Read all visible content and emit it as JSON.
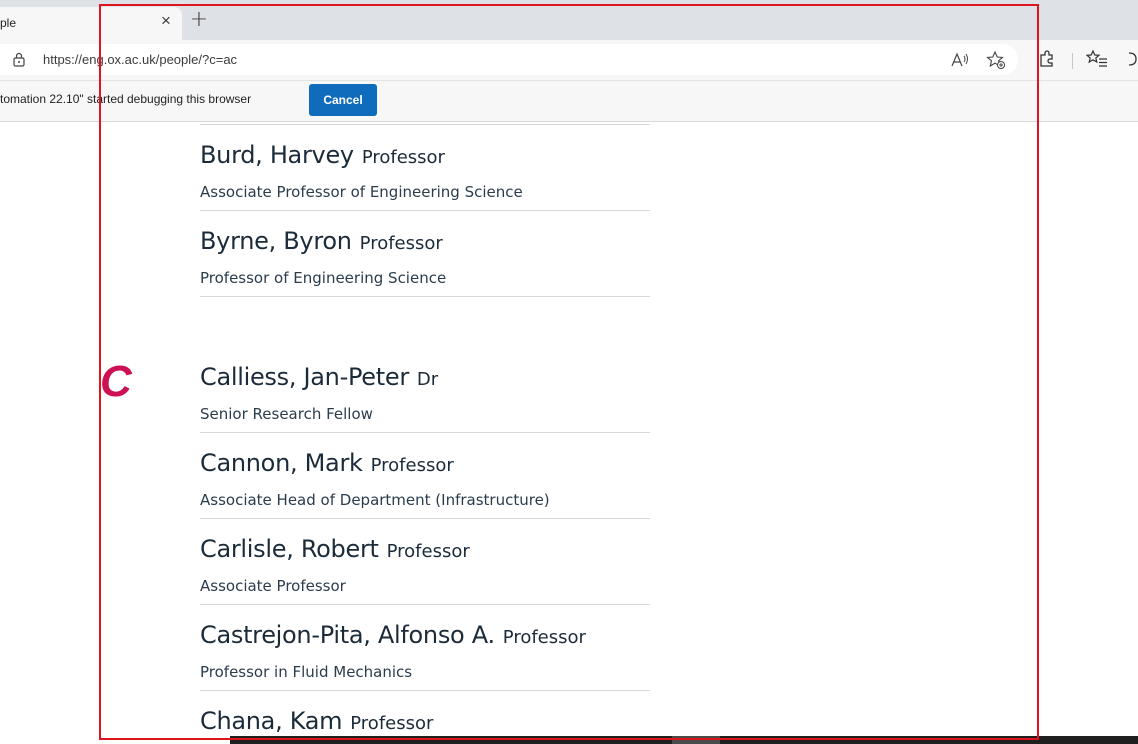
{
  "browser": {
    "tab": {
      "title": "ple",
      "close": "×"
    },
    "new_tab": "+",
    "url": "https://eng.ox.ac.uk/people/?c=ac",
    "read_aloud_icon": "read-aloud-icon",
    "favorite_icon": "add-favorite-icon",
    "extensions_icon": "extensions-icon",
    "favorites_icon": "favorites-icon",
    "more_icon": "more-icon"
  },
  "infobar": {
    "text": "tomation 22.10\" started debugging this browser",
    "cancel_label": "Cancel"
  },
  "directory": {
    "letter": "C",
    "accent_color": "#cc1155",
    "people_b": [
      {
        "name": "Burd, Harvey",
        "title": "Professor",
        "role": "Associate Professor of Engineering Science"
      },
      {
        "name": "Byrne, Byron",
        "title": "Professor",
        "role": "Professor of Engineering Science"
      }
    ],
    "people_c": [
      {
        "name": "Calliess, Jan-Peter",
        "title": "Dr",
        "role": "Senior Research Fellow"
      },
      {
        "name": "Cannon, Mark",
        "title": "Professor",
        "role": "Associate Head of Department (Infrastructure)"
      },
      {
        "name": "Carlisle, Robert",
        "title": "Professor",
        "role": "Associate Professor"
      },
      {
        "name": "Castrejon-Pita, Alfonso A.",
        "title": "Professor",
        "role": "Professor in Fluid Mechanics"
      },
      {
        "name": "Chana, Kam",
        "title": "Professor",
        "role": ""
      }
    ]
  }
}
